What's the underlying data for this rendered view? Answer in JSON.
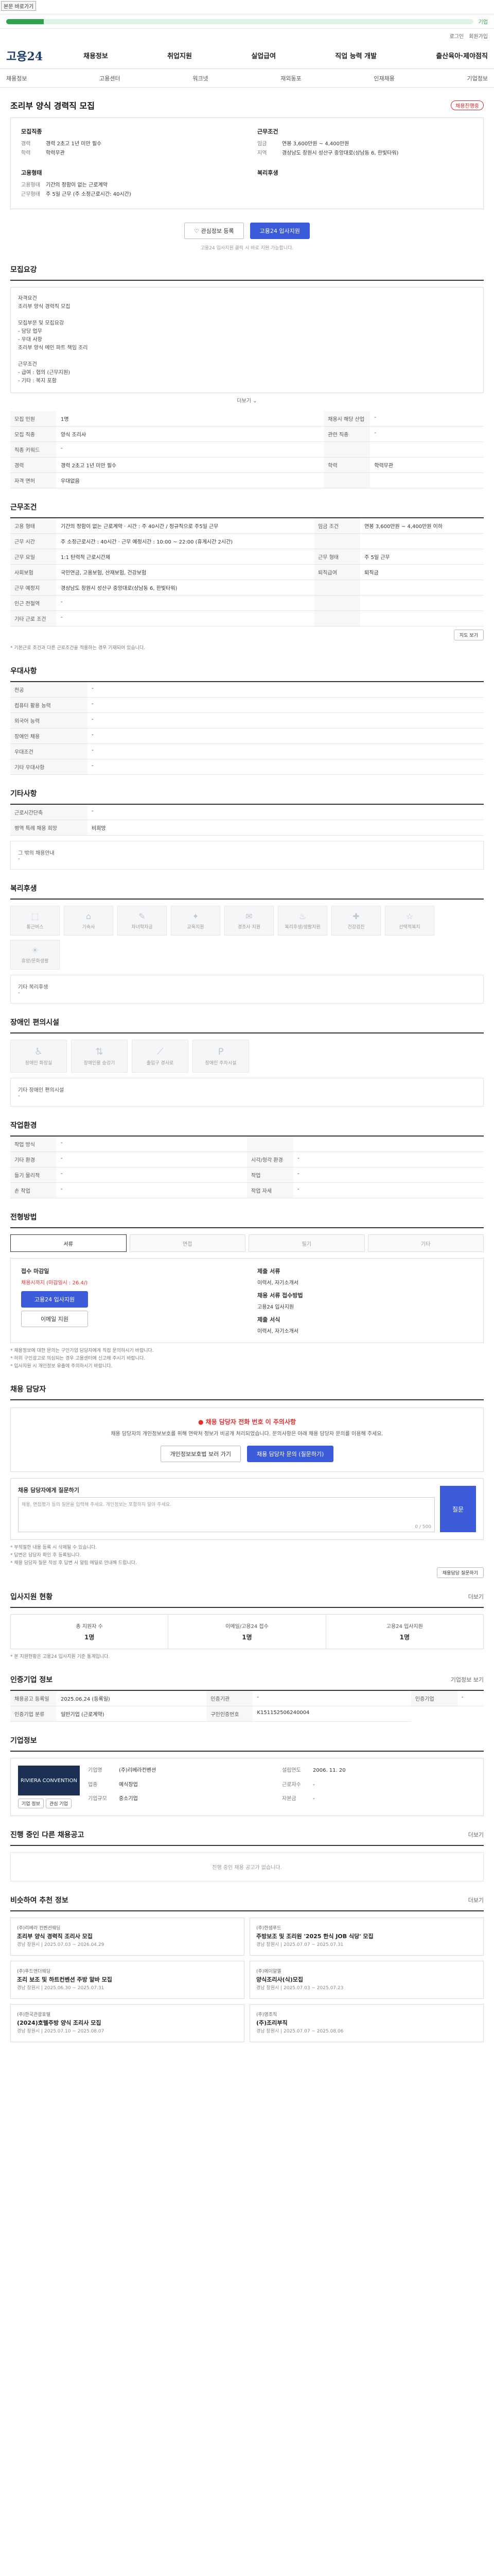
{
  "skip_link": "본문 바로가기",
  "progress": {
    "value_percent": 8,
    "label": "기업"
  },
  "util_links": [
    "로그인",
    "회원가입"
  ],
  "logo": "고용24",
  "gnb": [
    "채용정보",
    "취업지원",
    "실업급여",
    "직업 능력 개발",
    "출산육아·제야점직"
  ],
  "subnav": [
    "채용정보",
    "고용센터",
    "워크넷",
    "재외동포",
    "인재채용",
    "기업정보"
  ],
  "job": {
    "title": "조리부 양식 경력직 모집",
    "badge": "채용진행중",
    "company_h": "모집직종",
    "company_rows": [
      {
        "k": "경력",
        "v": "경력 2초고 1년 미만 필수"
      },
      {
        "k": "학력",
        "v": "학력무관"
      }
    ],
    "cond_h": "근무조건",
    "cond_rows": [
      {
        "k": "임금",
        "v": "연봉 3,600만원 ~ 4,400만원"
      },
      {
        "k": "지역",
        "v": "경상남도 창원시 성산구 중앙대로(상남동 6, 한빛타워)"
      }
    ],
    "form_h": "고용형태",
    "form_rows": [
      {
        "k": "고용형태",
        "v": "기간의 정함이 없는 근로계약"
      },
      {
        "k": "근무형태",
        "v": "주 5일 근무 (주 소정근로시간: 40시간)"
      }
    ],
    "welfare_h": "복리후생",
    "btn_save": "관심정보 등록",
    "btn_apply": "고용24 입사지원",
    "note": "고용24 입사지원 클릭 시 바로 지원 가능합니다."
  },
  "requirement": {
    "title": "모집요강",
    "desc": [
      "자격요건",
      "조리부 양식 경력직 모집",
      "",
      "모집부문 및 모집요강",
      "- 담당 업무",
      "- 우대 사항",
      "조리부 양식 메인 파트 책임 조리",
      "",
      "근무조건",
      "- 급여 : 협의 (근무지원)",
      "- 기타 : 복지 포함"
    ],
    "fold": "더보기",
    "rows": [
      [
        {
          "k": "모집 인원",
          "v": "1명"
        },
        {
          "k": "채용시 해당 산업",
          "v": "-"
        }
      ],
      [
        {
          "k": "모집 직종",
          "v": "양식 조리사"
        },
        {
          "k": "관련 직종",
          "v": "-"
        }
      ],
      [
        {
          "k": "직종 키워드",
          "v": "-"
        },
        {
          "k": "",
          "v": ""
        }
      ],
      [
        {
          "k": "경력",
          "v": "경력 2초고 1년 미만 필수"
        },
        {
          "k": "학력",
          "v": "학력무관"
        }
      ],
      [
        {
          "k": "자격 면허",
          "v": "우대없음"
        },
        {
          "k": "",
          "v": ""
        }
      ]
    ]
  },
  "conditions": {
    "title": "근무조건",
    "rows": [
      [
        {
          "k": "고용 형태",
          "v": "기간의 정함이 없는 근로계약 · 시간 : 주 40시간 / 정규직으로 주5일 근무"
        },
        {
          "k": "임금 조건",
          "v": "연봉 3,600만원 ~ 4,400만원 이하"
        }
      ],
      [
        {
          "k": "근무 시간",
          "v": "주 소정근로시간 : 40시간 · 근무 예정시간 : 10:00 ~ 22:00 (휴게시간 2시간)"
        },
        {
          "k": "",
          "v": ""
        }
      ],
      [
        {
          "k": "근무 요일",
          "v": "1:1 탄력적 근로시간제"
        },
        {
          "k": "근무 형태",
          "v": "주 5일 근무"
        }
      ],
      [
        {
          "k": "사회보험",
          "v": "국민연금, 고용보험, 산재보험, 건강보험"
        },
        {
          "k": "퇴직급여",
          "v": "퇴직금"
        }
      ],
      [
        {
          "k": "근무 예정지",
          "v": "경상남도 창원시 성산구 중앙대로(상남동 6, 한빛타워)"
        },
        {
          "k": "",
          "v": ""
        }
      ],
      [
        {
          "k": "인근 전철역",
          "v": "-"
        },
        {
          "k": "",
          "v": ""
        }
      ],
      [
        {
          "k": "기타 근로 조건",
          "v": "-"
        },
        {
          "k": "",
          "v": ""
        }
      ]
    ],
    "map_btn": "지도 보기",
    "footnote": "* 기본근로 조건과 다른 근로조건을 적용하는 경우 기재되어 있습니다."
  },
  "preference": {
    "title": "우대사항",
    "rows": [
      {
        "k": "전공",
        "v": "-"
      },
      {
        "k": "컴퓨터 활용 능력",
        "v": "-"
      },
      {
        "k": "외국어 능력",
        "v": "-"
      },
      {
        "k": "장애인 채용",
        "v": "-"
      },
      {
        "k": "우대조건",
        "v": "-"
      },
      {
        "k": "기타 우대사항",
        "v": "-"
      }
    ]
  },
  "other": {
    "title": "기타사항",
    "rows": [
      {
        "k": "근로시간단축",
        "v": "-"
      },
      {
        "k": "병역 특례 채용 희망",
        "v": "비희망"
      }
    ],
    "extra_h": "그 밖의 채용안내",
    "extra_v": "-"
  },
  "welfare": {
    "title": "복리후생",
    "tiles": [
      "통근버스",
      "기숙사",
      "자녀학자금",
      "교육지원",
      "경조사 지원",
      "복리후생/생활지원",
      "건강검진",
      "선택적복지",
      "휴양/문화생활"
    ],
    "extra_h": "기타 복리후생",
    "extra_v": "-"
  },
  "disabled": {
    "title": "장애인 편의시설",
    "tiles": [
      "장애인 화장실",
      "장애인용 승강기",
      "출입구 경사로",
      "장애인 주차시설"
    ],
    "extra_h": "기타 장애인 편의시설",
    "extra_v": "-"
  },
  "env": {
    "title": "작업환경",
    "rows": [
      [
        {
          "k": "작업 방식",
          "v": "-"
        },
        {
          "k": "",
          "v": ""
        }
      ],
      [
        {
          "k": "기타 환경",
          "v": "-"
        },
        {
          "k": "시각/청각 환경",
          "v": "-"
        }
      ],
      [
        {
          "k": "들기 물리적",
          "v": "-"
        },
        {
          "k": "작업",
          "v": "-"
        }
      ],
      [
        {
          "k": "손 작업",
          "v": "-"
        },
        {
          "k": "작업 자세",
          "v": "-"
        }
      ]
    ]
  },
  "method": {
    "title": "전형방법",
    "tabs": [
      "서류",
      "면접",
      "필기",
      "기타"
    ],
    "active": 0,
    "apply_h": "접수 마감일",
    "apply_v": "채용시까지 (마감일시 : 26.4/)",
    "apply_btn": "고용24 입사지원",
    "email_btn": "이메일 지원",
    "docs_h": "제출 서류",
    "docs_v": "이력서, 자기소개서",
    "way_h": "채용 서류 접수방법",
    "way_v": "고용24 입사지원",
    "form_h": "제출 서식",
    "form_v": "이력서, 자기소개서",
    "bullets": [
      "* 채용정보에 대한 문의는 구인기업 담당자에게 직접 문의하시기 바랍니다.",
      "* 허위 구인광고로 의심되는 경우 고용센터에 신고해 주시기 바랍니다.",
      "* 입사지원 시 개인정보 유출에 주의하시기 바랍니다."
    ]
  },
  "contact": {
    "title": "채용 담당자",
    "warn_title": "채용 담당자 전화 번호 이 주의사항",
    "warn_text": "채용 담당자의 개인정보보호를 위해 연락처 정보가 비공개 처리되었습니다. 문의사항은 아래 채용 담당자 문의를 이용해 주세요.",
    "btn_info": "개인정보보호법 보러 가기",
    "btn_ask": "채용 담당자 문의 (질문하기)",
    "inquiry_h": "채용 담당자에게 질문하기",
    "inquiry_ph": "채용, 면접평가 등의 질문을 입력해 주세요. 개인정보는 포함하지 말아 주세요.",
    "inquiry_count": "0 / 500",
    "inquiry_btn": "질문",
    "bullets": [
      "* 부적절한 내용 등록 시 삭제될 수 있습니다.",
      "* 답변은 담당자 확인 후 등록됩니다.",
      "* 채용 담당자 질문 작성 후 답변 시 알림 메일로 안내해 드립니다."
    ],
    "more_btn": "채용담당 질문하기"
  },
  "stats": {
    "title": "입사지원 현황",
    "more": "더보기",
    "items": [
      {
        "lbl": "총 지원자 수",
        "num": "1명"
      },
      {
        "lbl": "이메일/고용24 접수",
        "num": "1명"
      },
      {
        "lbl": "고용24 입사지원",
        "num": "1명"
      }
    ],
    "note": "* 본 지원현황은 고용24 입사지원 기준 통계입니다."
  },
  "info": {
    "title": "인증기업 정보",
    "more": "기업정보 보기",
    "rows": [
      [
        {
          "k": "채용공고 등록일",
          "v": "2025.06.24 (등록일)"
        },
        {
          "k": "인증기관",
          "v": "-"
        },
        {
          "k": "인증기업",
          "v": "-"
        }
      ],
      [
        {
          "k": "인증기업 분류",
          "v": "일반기업 (근로계약)"
        },
        {
          "k": "구인인증번호",
          "v": "K151152506240004"
        }
      ]
    ]
  },
  "company": {
    "title": "기업정보",
    "logo": "RIVIERA CONVENTION",
    "btn1": "기업 정보",
    "btn2": "관심 기업",
    "rows": [
      [
        {
          "k": "기업명",
          "v": "(주)리베라컨벤션"
        },
        {
          "k": "설립연도",
          "v": "2006. 11. 20"
        }
      ],
      [
        {
          "k": "업종",
          "v": "예식장업"
        },
        {
          "k": "근로자수",
          "v": "-"
        }
      ],
      [
        {
          "k": "기업규모",
          "v": "중소기업"
        },
        {
          "k": "자본금",
          "v": "-"
        }
      ]
    ]
  },
  "others": {
    "title": "진행 중인 다른 채용공고",
    "more": "더보기",
    "empty": "진행 중인 채용 공고가 없습니다."
  },
  "recommend": {
    "title": "비슷하여 추천 정보",
    "more": "더보기",
    "items": [
      {
        "co": "(주)리베라 컨벤션웨딩",
        "tt": "조리부 양식 경력직 조리사 모집",
        "meta": "경남 창원시  |  2025.07.03 ~ 2026.04.29"
      },
      {
        "co": "(주)한샘푸드",
        "tt": "주방보조 및 조리원 '2025 한식 JOB 식당' 모집",
        "meta": "경남 창원시  |  2025.07.07 ~ 2025.07.31"
      },
      {
        "co": "(주)푸드앤더웨딩",
        "tt": "조리 보조 및 하트컨벤션 주방 알바 모집",
        "meta": "경남 창원시  |  2025.06.30 ~ 2025.07.31"
      },
      {
        "co": "(주)에이알엘",
        "tt": "양식조리사(식)모집",
        "meta": "경남 창원시  |  2025.07.03 ~ 2025.07.23"
      },
      {
        "co": "(주)한국관광호텔",
        "tt": "(2024)호텔주방 양식 조리사 모집",
        "meta": "경남 창원시  |  2025.07.10 ~ 2025.08.07"
      },
      {
        "co": "(주)영조직",
        "tt": "(주)조리부직",
        "meta": "경남 창원시  |  2025.07.07 ~ 2025.08.06"
      }
    ]
  },
  "colors": {
    "primary": "#3b5bdb",
    "progress": "#2ea44f",
    "alert": "#e03131",
    "navy": "#1d3c6e"
  }
}
